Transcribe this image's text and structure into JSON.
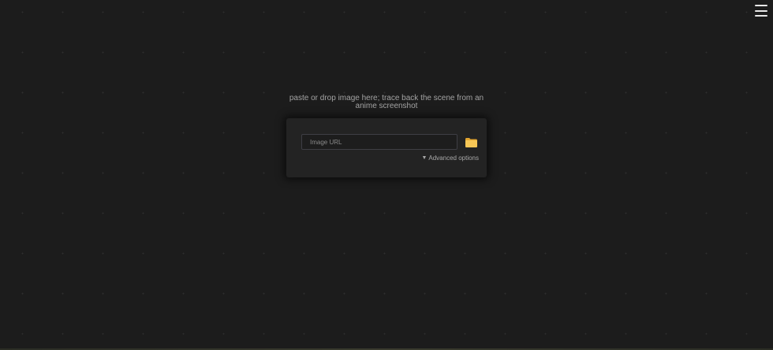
{
  "header": {
    "menu_icon": "hamburger-menu-icon"
  },
  "main": {
    "tagline": "paste or drop image here; trace back the scene from an anime screenshot",
    "search": {
      "value": "",
      "placeholder": "Image URL"
    },
    "file_button_icon": "folder-icon",
    "advanced_options_arrow": "▼",
    "advanced_options_label": "Advanced options"
  },
  "colors": {
    "background": "#1c1c1c",
    "card": "#232323",
    "folder": "#f5c04a"
  }
}
